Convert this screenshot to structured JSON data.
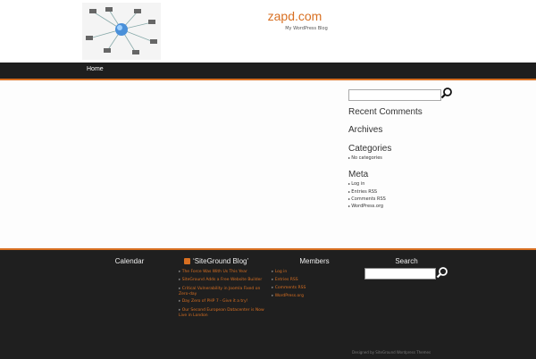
{
  "header": {
    "site_title": "zapd.com",
    "tagline": "My WordPress Blog"
  },
  "nav": {
    "home": "Home"
  },
  "sidebar": {
    "search_placeholder": "",
    "recent_comments": "Recent Comments",
    "archives": "Archives",
    "categories": "Categories",
    "categories_items": [
      "No categories"
    ],
    "meta": "Meta",
    "meta_items": [
      "Log in",
      "Entries RSS",
      "Comments RSS",
      "WordPress.org"
    ]
  },
  "footer": {
    "calendar": "Calendar",
    "siteground_blog": "SiteGround Blog",
    "blog_items": [
      "The Force Was With Us This Year",
      "SiteGround Adds a Free Website Builder",
      "Critical Vulnerability in Joomla Fixed on Zero-day",
      "Day Zero of PHP 7 - Give it a try!",
      "Our Second European Datacenter is Now Live in London"
    ],
    "members": "Members",
    "members_items": [
      "Log in",
      "Entries RSS",
      "Comments RSS",
      "WordPress.org"
    ],
    "search": "Search",
    "credit": "Designed by SiteGround Wordpress Themes"
  },
  "colors": {
    "accent": "#d86f21",
    "dark": "#1f1f1f"
  },
  "icons": {
    "search": "magnifier-icon",
    "rss": "rss-icon"
  }
}
